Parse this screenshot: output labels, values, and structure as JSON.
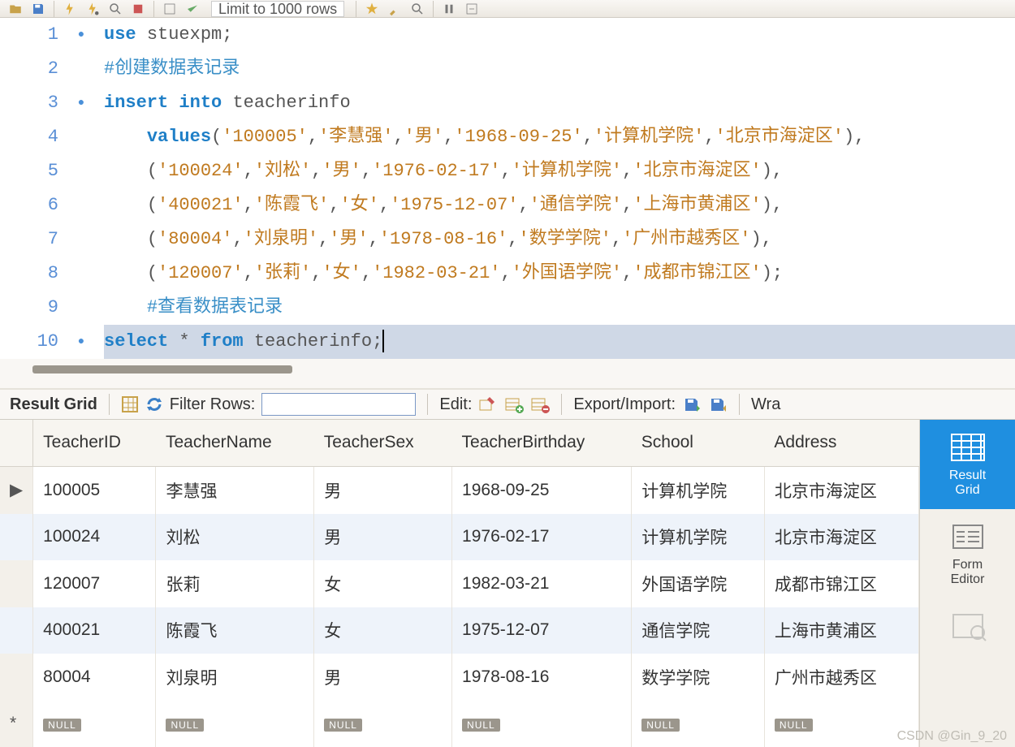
{
  "toolbar": {
    "limit_label": "Limit to 1000 rows"
  },
  "editor": {
    "lines": [
      {
        "n": "1",
        "dot": true,
        "html": [
          [
            "kw",
            "use "
          ],
          [
            "ident",
            "stuexpm"
          ],
          [
            "punc",
            ";"
          ]
        ]
      },
      {
        "n": "2",
        "dot": false,
        "html": [
          [
            "cmt",
            "#创建数据表记录"
          ]
        ]
      },
      {
        "n": "3",
        "dot": true,
        "html": [
          [
            "kw",
            "insert into "
          ],
          [
            "ident",
            "teacherinfo"
          ]
        ]
      },
      {
        "n": "4",
        "dot": false,
        "html": [
          [
            "pad",
            "    "
          ],
          [
            "kw",
            "values"
          ],
          [
            "punc",
            "("
          ],
          [
            "str",
            "'100005'"
          ],
          [
            "punc",
            ","
          ],
          [
            "str",
            "'李慧强'"
          ],
          [
            "punc",
            ","
          ],
          [
            "str",
            "'男'"
          ],
          [
            "punc",
            ","
          ],
          [
            "str",
            "'1968-09-25'"
          ],
          [
            "punc",
            ","
          ],
          [
            "str",
            "'计算机学院'"
          ],
          [
            "punc",
            ","
          ],
          [
            "str",
            "'北京市海淀区'"
          ],
          [
            "punc",
            "),"
          ]
        ]
      },
      {
        "n": "5",
        "dot": false,
        "html": [
          [
            "pad",
            "    "
          ],
          [
            "punc",
            "("
          ],
          [
            "str",
            "'100024'"
          ],
          [
            "punc",
            ","
          ],
          [
            "str",
            "'刘松'"
          ],
          [
            "punc",
            ","
          ],
          [
            "str",
            "'男'"
          ],
          [
            "punc",
            ","
          ],
          [
            "str",
            "'1976-02-17'"
          ],
          [
            "punc",
            ","
          ],
          [
            "str",
            "'计算机学院'"
          ],
          [
            "punc",
            ","
          ],
          [
            "str",
            "'北京市海淀区'"
          ],
          [
            "punc",
            "),"
          ]
        ]
      },
      {
        "n": "6",
        "dot": false,
        "html": [
          [
            "pad",
            "    "
          ],
          [
            "punc",
            "("
          ],
          [
            "str",
            "'400021'"
          ],
          [
            "punc",
            ","
          ],
          [
            "str",
            "'陈霞飞'"
          ],
          [
            "punc",
            ","
          ],
          [
            "str",
            "'女'"
          ],
          [
            "punc",
            ","
          ],
          [
            "str",
            "'1975-12-07'"
          ],
          [
            "punc",
            ","
          ],
          [
            "str",
            "'通信学院'"
          ],
          [
            "punc",
            ","
          ],
          [
            "str",
            "'上海市黄浦区'"
          ],
          [
            "punc",
            "),"
          ]
        ]
      },
      {
        "n": "7",
        "dot": false,
        "html": [
          [
            "pad",
            "    "
          ],
          [
            "punc",
            "("
          ],
          [
            "str",
            "'80004'"
          ],
          [
            "punc",
            ","
          ],
          [
            "str",
            "'刘泉明'"
          ],
          [
            "punc",
            ","
          ],
          [
            "str",
            "'男'"
          ],
          [
            "punc",
            ","
          ],
          [
            "str",
            "'1978-08-16'"
          ],
          [
            "punc",
            ","
          ],
          [
            "str",
            "'数学学院'"
          ],
          [
            "punc",
            ","
          ],
          [
            "str",
            "'广州市越秀区'"
          ],
          [
            "punc",
            "),"
          ]
        ]
      },
      {
        "n": "8",
        "dot": false,
        "html": [
          [
            "pad",
            "    "
          ],
          [
            "punc",
            "("
          ],
          [
            "str",
            "'120007'"
          ],
          [
            "punc",
            ","
          ],
          [
            "str",
            "'张莉'"
          ],
          [
            "punc",
            ","
          ],
          [
            "str",
            "'女'"
          ],
          [
            "punc",
            ","
          ],
          [
            "str",
            "'1982-03-21'"
          ],
          [
            "punc",
            ","
          ],
          [
            "str",
            "'外国语学院'"
          ],
          [
            "punc",
            ","
          ],
          [
            "str",
            "'成都市锦江区'"
          ],
          [
            "punc",
            ");"
          ]
        ]
      },
      {
        "n": "9",
        "dot": false,
        "html": [
          [
            "pad",
            "    "
          ],
          [
            "cmt",
            "#查看数据表记录"
          ]
        ]
      },
      {
        "n": "10",
        "dot": true,
        "sel": true,
        "html": [
          [
            "kw",
            "select "
          ],
          [
            "punc",
            "* "
          ],
          [
            "kw",
            "from "
          ],
          [
            "ident",
            "teacherinfo"
          ],
          [
            "punc",
            ";"
          ]
        ],
        "cursor": true
      }
    ]
  },
  "result_bar": {
    "title": "Result Grid",
    "filter_label": "Filter Rows:",
    "filter_value": "",
    "edit_label": "Edit:",
    "export_label": "Export/Import:",
    "wrap_label": "Wra"
  },
  "grid": {
    "columns": [
      "TeacherID",
      "TeacherName",
      "TeacherSex",
      "TeacherBirthday",
      "School",
      "Address"
    ],
    "rows": [
      {
        "marker": "▶",
        "cells": [
          "100005",
          "李慧强",
          "男",
          "1968-09-25",
          "计算机学院",
          "北京市海淀区"
        ],
        "alt": false
      },
      {
        "marker": "",
        "cells": [
          "100024",
          "刘松",
          "男",
          "1976-02-17",
          "计算机学院",
          "北京市海淀区"
        ],
        "alt": true
      },
      {
        "marker": "",
        "cells": [
          "120007",
          "张莉",
          "女",
          "1982-03-21",
          "外国语学院",
          "成都市锦江区"
        ],
        "alt": false
      },
      {
        "marker": "",
        "cells": [
          "400021",
          "陈霞飞",
          "女",
          "1975-12-07",
          "通信学院",
          "上海市黄浦区"
        ],
        "alt": true
      },
      {
        "marker": "",
        "cells": [
          "80004",
          "刘泉明",
          "男",
          "1978-08-16",
          "数学学院",
          "广州市越秀区"
        ],
        "alt": false
      },
      {
        "marker": "*",
        "cells": [
          "NULL",
          "NULL",
          "NULL",
          "NULL",
          "NULL",
          "NULL"
        ],
        "null": true,
        "alt": false
      }
    ]
  },
  "sidepanel": {
    "result_grid": "Result\nGrid",
    "form_editor": "Form\nEditor"
  },
  "watermark": "CSDN @Gin_9_20"
}
